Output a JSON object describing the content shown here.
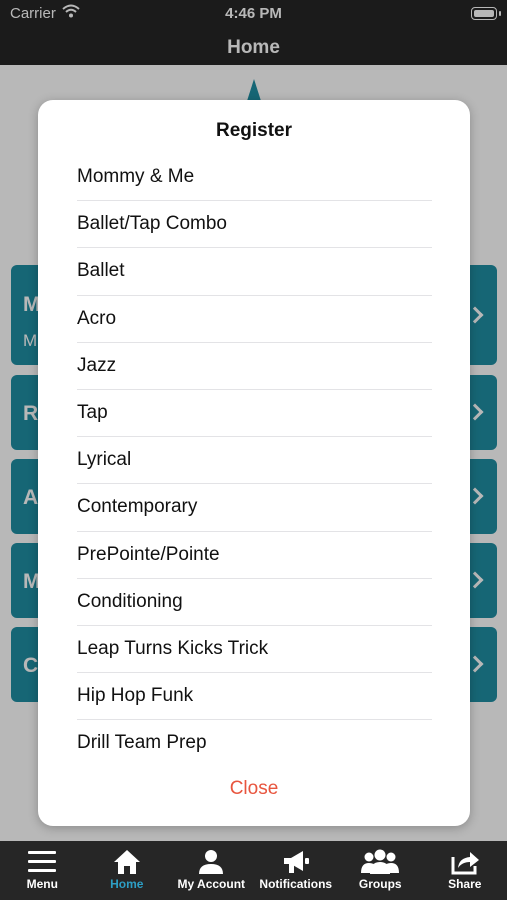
{
  "status_bar": {
    "carrier": "Carrier",
    "time": "4:46 PM"
  },
  "nav_bar": {
    "title": "Home"
  },
  "background": {
    "cards": [
      {
        "letter": "M",
        "sub": "M"
      },
      {
        "letter": "R"
      },
      {
        "letter": "A"
      },
      {
        "letter": "M"
      },
      {
        "letter": "C"
      }
    ]
  },
  "modal": {
    "title": "Register",
    "options": [
      "Mommy & Me",
      "Ballet/Tap Combo",
      "Ballet",
      "Acro",
      "Jazz",
      "Tap",
      "Lyrical",
      "Contemporary",
      "PrePointe/Pointe",
      "Conditioning",
      "Leap Turns Kicks Trick",
      "Hip Hop Funk",
      "Drill Team Prep"
    ],
    "close_label": "Close"
  },
  "tab_bar": {
    "tabs": [
      {
        "label": "Menu",
        "icon": "hamburger-icon"
      },
      {
        "label": "Home",
        "icon": "home-icon",
        "active": true
      },
      {
        "label": "My Account",
        "icon": "user-icon"
      },
      {
        "label": "Notifications",
        "icon": "megaphone-icon"
      },
      {
        "label": "Groups",
        "icon": "group-icon"
      },
      {
        "label": "Share",
        "icon": "share-icon"
      }
    ]
  },
  "colors": {
    "accent": "#1f8ea3",
    "active_tab": "#2d9ec4",
    "close": "#e8553e",
    "bar": "#262626"
  }
}
